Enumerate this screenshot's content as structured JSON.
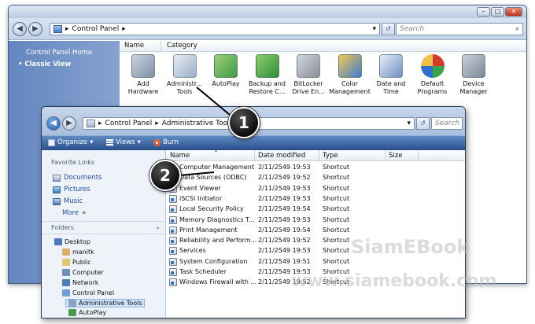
{
  "control_panel": {
    "breadcrumb": [
      "Control Panel"
    ],
    "search_placeholder": "Search",
    "left_links": [
      "Control Panel Home",
      "Classic View"
    ],
    "columns": [
      "Name",
      "Category"
    ],
    "items": [
      {
        "label": "Add\nHardware",
        "icon": "add-hardware-icon"
      },
      {
        "label": "Administr...\nTools",
        "icon": "admin-tools-icon"
      },
      {
        "label": "AutoPlay",
        "icon": "autoplay-icon"
      },
      {
        "label": "Backup and\nRestore C...",
        "icon": "backup-icon"
      },
      {
        "label": "BitLocker\nDrive En...",
        "icon": "bitlocker-icon"
      },
      {
        "label": "Color\nManagement",
        "icon": "color-management-icon"
      },
      {
        "label": "Date and\nTime",
        "icon": "date-time-icon"
      },
      {
        "label": "Default\nPrograms",
        "icon": "default-programs-icon"
      },
      {
        "label": "Device\nManager",
        "icon": "device-manager-icon"
      }
    ]
  },
  "admin_tools": {
    "breadcrumb": [
      "Control Panel",
      "Administrative Tools"
    ],
    "search_placeholder": "Search",
    "toolbar": {
      "organize": "Organize",
      "views": "Views",
      "burn": "Burn"
    },
    "favorite_links_header": "Favorite Links",
    "favorites": [
      "Documents",
      "Pictures",
      "Music"
    ],
    "more_label": "More",
    "more_arrows": "»",
    "folders_header": "Folders",
    "folders": [
      "Desktop",
      "manitk",
      "Public",
      "Computer",
      "Network",
      "Control Panel",
      "Administrative Tools",
      "AutoPlay"
    ],
    "columns": {
      "name": "Name",
      "date": "Date modified",
      "type": "Type",
      "size": "Size"
    },
    "rows": [
      {
        "name": "Computer Management",
        "date": "2/11/2549 19:53",
        "type": "Shortcut"
      },
      {
        "name": "Data Sources (ODBC)",
        "date": "2/11/2549 19:52",
        "type": "Shortcut"
      },
      {
        "name": "Event Viewer",
        "date": "2/11/2549 19:53",
        "type": "Shortcut"
      },
      {
        "name": "iSCSI Initiator",
        "date": "2/11/2549 19:53",
        "type": "Shortcut"
      },
      {
        "name": "Local Security Policy",
        "date": "2/11/2549 19:54",
        "type": "Shortcut"
      },
      {
        "name": "Memory Diagnostics T...",
        "date": "2/11/2549 19:53",
        "type": "Shortcut"
      },
      {
        "name": "Print Management",
        "date": "2/11/2549 19:54",
        "type": "Shortcut"
      },
      {
        "name": "Reliability and Perform...",
        "date": "2/11/2549 19:52",
        "type": "Shortcut"
      },
      {
        "name": "Services",
        "date": "2/11/2549 19:53",
        "type": "Shortcut"
      },
      {
        "name": "System Configuration",
        "date": "2/11/2549 19:51",
        "type": "Shortcut"
      },
      {
        "name": "Task Scheduler",
        "date": "2/11/2549 19:53",
        "type": "Shortcut"
      },
      {
        "name": "Windows Firewall with ...",
        "date": "2/11/2549 19:52",
        "type": "Shortcut"
      }
    ]
  },
  "callouts": [
    "1",
    "2"
  ],
  "watermark": {
    "line1": "SiamEBook",
    "line2": "www.siamebook.com"
  }
}
